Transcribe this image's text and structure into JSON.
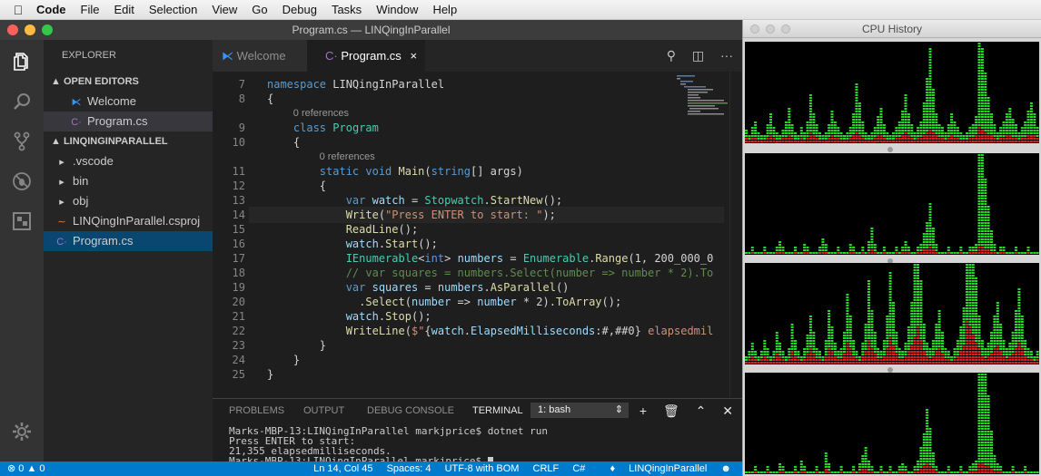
{
  "menubar": {
    "app": "Code",
    "items": [
      "File",
      "Edit",
      "Selection",
      "View",
      "Go",
      "Debug",
      "Tasks",
      "Window",
      "Help"
    ]
  },
  "window": {
    "title": "Program.cs — LINQingInParallel"
  },
  "activity": [
    "files-icon",
    "search-icon",
    "source-control-icon",
    "debug-icon",
    "extensions-icon",
    "settings-icon"
  ],
  "sidebar": {
    "title": "EXPLORER",
    "open_editors_header": "▲ OPEN EDITORS",
    "open_editors": [
      {
        "label": "Welcome",
        "icon": "vscode-icon"
      },
      {
        "label": "Program.cs",
        "icon": "csharp-icon"
      }
    ],
    "project_header": "▲ LINQINGINPARALLEL",
    "project": [
      {
        "label": ".vscode",
        "icon": "▸"
      },
      {
        "label": "bin",
        "icon": "▸"
      },
      {
        "label": "obj",
        "icon": "▸"
      },
      {
        "label": "LINQingInParallel.csproj",
        "icon": "rss-icon"
      },
      {
        "label": "Program.cs",
        "icon": "csharp-icon"
      }
    ]
  },
  "tabs": [
    {
      "label": "Welcome"
    },
    {
      "label": "Program.cs",
      "close": "×"
    }
  ],
  "editor": {
    "lines": [
      {
        "n": "7",
        "tokens": [
          [
            "kw",
            "namespace "
          ],
          [
            "",
            "LINQingInParallel"
          ]
        ]
      },
      {
        "n": "8",
        "tokens": [
          [
            "",
            "{"
          ]
        ]
      },
      {
        "lens": "0 references"
      },
      {
        "n": "9",
        "tokens": [
          [
            "",
            "    "
          ],
          [
            "kw",
            "class "
          ],
          [
            "ty",
            "Program"
          ]
        ]
      },
      {
        "n": "10",
        "tokens": [
          [
            "",
            "    {"
          ]
        ]
      },
      {
        "lens": "0 references"
      },
      {
        "n": "11",
        "tokens": [
          [
            "",
            "        "
          ],
          [
            "kw",
            "static void "
          ],
          [
            "fn",
            "Main"
          ],
          [
            "",
            "("
          ],
          [
            "kw",
            "string"
          ],
          [
            "",
            "[] args)"
          ]
        ]
      },
      {
        "n": "12",
        "tokens": [
          [
            "",
            "        {"
          ]
        ]
      },
      {
        "n": "13",
        "tokens": [
          [
            "",
            "            "
          ],
          [
            "kw",
            "var "
          ],
          [
            "vr",
            "watch"
          ],
          [
            "",
            " = "
          ],
          [
            "ty",
            "Stopwatch"
          ],
          [
            "",
            "."
          ],
          [
            "fn",
            "StartNew"
          ],
          [
            "",
            "();"
          ]
        ]
      },
      {
        "n": "14",
        "tokens": [
          [
            "",
            "            "
          ],
          [
            "fn",
            "Write"
          ],
          [
            "",
            "("
          ],
          [
            "st",
            "\"Press ENTER to start: \""
          ],
          [
            "",
            ");"
          ]
        ]
      },
      {
        "n": "15",
        "tokens": [
          [
            "",
            "            "
          ],
          [
            "fn",
            "ReadLine"
          ],
          [
            "",
            "();"
          ]
        ]
      },
      {
        "n": "16",
        "tokens": [
          [
            "",
            "            "
          ],
          [
            "vr",
            "watch"
          ],
          [
            "",
            "."
          ],
          [
            "fn",
            "Start"
          ],
          [
            "",
            "();"
          ]
        ]
      },
      {
        "n": "17",
        "tokens": [
          [
            "",
            "            "
          ],
          [
            "ty",
            "IEnumerable"
          ],
          [
            "",
            "<"
          ],
          [
            "kw",
            "int"
          ],
          [
            "",
            "> "
          ],
          [
            "vr",
            "numbers"
          ],
          [
            "",
            " = "
          ],
          [
            "ty",
            "Enumerable"
          ],
          [
            "",
            "."
          ],
          [
            "fn",
            "Range"
          ],
          [
            "",
            "(1, 200_000_0"
          ]
        ]
      },
      {
        "n": "18",
        "tokens": [
          [
            "",
            "            "
          ],
          [
            "cm",
            "// var squares = numbers.Select(number => number * 2).To"
          ]
        ]
      },
      {
        "n": "19",
        "tokens": [
          [
            "",
            "            "
          ],
          [
            "kw",
            "var "
          ],
          [
            "vr",
            "squares"
          ],
          [
            "",
            " = "
          ],
          [
            "vr",
            "numbers"
          ],
          [
            "",
            "."
          ],
          [
            "fn",
            "AsParallel"
          ],
          [
            "",
            "()"
          ]
        ]
      },
      {
        "n": "20",
        "tokens": [
          [
            "",
            "              ."
          ],
          [
            "fn",
            "Select"
          ],
          [
            "",
            "("
          ],
          [
            "vr",
            "number"
          ],
          [
            "",
            " => "
          ],
          [
            "vr",
            "number"
          ],
          [
            "",
            " * 2)."
          ],
          [
            "fn",
            "ToArray"
          ],
          [
            "",
            "();"
          ]
        ]
      },
      {
        "n": "21",
        "tokens": [
          [
            "",
            "            "
          ],
          [
            "vr",
            "watch"
          ],
          [
            "",
            "."
          ],
          [
            "fn",
            "Stop"
          ],
          [
            "",
            "();"
          ]
        ]
      },
      {
        "n": "22",
        "tokens": [
          [
            "",
            "            "
          ],
          [
            "fn",
            "WriteLine"
          ],
          [
            "",
            "("
          ],
          [
            "st",
            "$\""
          ],
          [
            "",
            "{"
          ],
          [
            "vr",
            "watch"
          ],
          [
            "",
            "."
          ],
          [
            "vr",
            "ElapsedMilliseconds"
          ],
          [
            "",
            ":#,##0} "
          ],
          [
            "st",
            "elapsedmil"
          ]
        ]
      },
      {
        "n": "23",
        "tokens": [
          [
            "",
            "        }"
          ]
        ]
      },
      {
        "n": "24",
        "tokens": [
          [
            "",
            "    }"
          ]
        ]
      },
      {
        "n": "25",
        "tokens": [
          [
            "",
            "}"
          ]
        ]
      }
    ]
  },
  "panel": {
    "tabs": [
      "PROBLEMS",
      "OUTPUT",
      "DEBUG CONSOLE",
      "TERMINAL"
    ],
    "active": "TERMINAL",
    "terminal_select": "1: bash",
    "terminal_lines": [
      "Marks-MBP-13:LINQingInParallel markjprice$ dotnet run",
      "Press ENTER to start:",
      "21,355 elapsedmilliseconds.",
      "Marks-MBP-13:LINQingInParallel markjprice$ "
    ]
  },
  "status": {
    "errors": "⊗ 0",
    "warnings": "▲ 0",
    "position": "Ln 14, Col 45",
    "spaces": "Spaces: 4",
    "encoding": "UTF-8 with BOM",
    "eol": "CRLF",
    "language": "C#",
    "project": "LINQingInParallel",
    "feedback": "☻"
  },
  "cpu": {
    "title": "CPU History",
    "colors": {
      "user": "#22dd22",
      "system": "#dd2222",
      "background": "#000000"
    },
    "graphs": [
      {
        "user": [
          3,
          2,
          4,
          6,
          3,
          2,
          2,
          5,
          8,
          4,
          3,
          2,
          3,
          6,
          10,
          5,
          3,
          2,
          4,
          3,
          6,
          14,
          8,
          5,
          3,
          2,
          3,
          5,
          9,
          6,
          4,
          3,
          2,
          3,
          4,
          8,
          18,
          12,
          6,
          3,
          2,
          3,
          4,
          7,
          10,
          5,
          3,
          2,
          3,
          4,
          6,
          9,
          14,
          8,
          5,
          3,
          4,
          6,
          12,
          20,
          30,
          16,
          8,
          5,
          4,
          3,
          5,
          8,
          6,
          4,
          3,
          2,
          3,
          4,
          5,
          7,
          38,
          30,
          22,
          14,
          8,
          5,
          3,
          4,
          6,
          8,
          10,
          7,
          5,
          3,
          4,
          6,
          9,
          12,
          8,
          4
        ],
        "system": [
          2,
          1,
          2,
          2,
          1,
          1,
          1,
          2,
          3,
          2,
          1,
          1,
          2,
          2,
          3,
          2,
          1,
          1,
          2,
          1,
          2,
          4,
          3,
          2,
          1,
          1,
          1,
          2,
          3,
          2,
          2,
          1,
          1,
          1,
          2,
          3,
          4,
          3,
          2,
          1,
          1,
          1,
          2,
          3,
          3,
          2,
          1,
          1,
          1,
          2,
          2,
          3,
          4,
          3,
          2,
          1,
          2,
          2,
          3,
          4,
          5,
          4,
          3,
          2,
          2,
          1,
          2,
          3,
          2,
          2,
          1,
          1,
          1,
          2,
          2,
          3,
          6,
          5,
          4,
          3,
          3,
          2,
          1,
          2,
          2,
          3,
          3,
          2,
          2,
          1,
          2,
          2,
          3,
          3,
          3,
          2
        ]
      },
      {
        "user": [
          1,
          1,
          2,
          1,
          1,
          1,
          2,
          1,
          1,
          1,
          2,
          4,
          2,
          1,
          1,
          1,
          2,
          1,
          1,
          3,
          2,
          1,
          1,
          1,
          2,
          5,
          3,
          1,
          1,
          1,
          2,
          1,
          1,
          1,
          3,
          2,
          1,
          1,
          2,
          1,
          4,
          8,
          3,
          1,
          1,
          2,
          1,
          1,
          1,
          2,
          1,
          2,
          4,
          2,
          1,
          1,
          2,
          3,
          6,
          10,
          16,
          8,
          3,
          1,
          1,
          1,
          2,
          1,
          1,
          1,
          2,
          1,
          1,
          2,
          2,
          3,
          40,
          34,
          26,
          16,
          8,
          3,
          1,
          2,
          2,
          1,
          1,
          1,
          2,
          1,
          1,
          1,
          2,
          1,
          1,
          1
        ],
        "system": [
          0,
          0,
          1,
          0,
          0,
          0,
          1,
          0,
          0,
          0,
          1,
          1,
          1,
          0,
          0,
          0,
          1,
          0,
          0,
          1,
          1,
          0,
          0,
          0,
          1,
          1,
          1,
          0,
          0,
          0,
          1,
          0,
          0,
          0,
          1,
          1,
          0,
          0,
          1,
          0,
          1,
          2,
          1,
          0,
          0,
          1,
          0,
          0,
          0,
          1,
          0,
          1,
          1,
          1,
          0,
          0,
          1,
          1,
          2,
          2,
          3,
          2,
          1,
          0,
          0,
          0,
          1,
          0,
          0,
          0,
          1,
          0,
          0,
          1,
          1,
          1,
          3,
          3,
          2,
          2,
          1,
          1,
          0,
          1,
          1,
          0,
          0,
          0,
          1,
          0,
          0,
          0,
          1,
          0,
          0,
          0
        ]
      },
      {
        "user": [
          2,
          3,
          5,
          3,
          2,
          3,
          6,
          4,
          2,
          3,
          8,
          5,
          3,
          2,
          4,
          10,
          6,
          3,
          2,
          4,
          7,
          12,
          8,
          4,
          3,
          2,
          6,
          14,
          9,
          5,
          3,
          4,
          8,
          18,
          12,
          6,
          3,
          2,
          5,
          10,
          22,
          14,
          8,
          4,
          3,
          6,
          12,
          24,
          16,
          8,
          4,
          3,
          5,
          9,
          16,
          28,
          40,
          22,
          10,
          5,
          4,
          6,
          10,
          14,
          8,
          4,
          3,
          2,
          4,
          6,
          9,
          14,
          52,
          44,
          36,
          24,
          12,
          6,
          4,
          5,
          8,
          12,
          16,
          10,
          6,
          4,
          5,
          8,
          14,
          20,
          12,
          6,
          4,
          3,
          2,
          3
        ],
        "system": [
          1,
          2,
          3,
          2,
          1,
          2,
          3,
          2,
          1,
          2,
          4,
          3,
          2,
          1,
          2,
          5,
          3,
          2,
          1,
          2,
          4,
          6,
          4,
          2,
          2,
          1,
          3,
          6,
          5,
          3,
          2,
          2,
          4,
          8,
          6,
          3,
          2,
          1,
          3,
          5,
          9,
          6,
          4,
          2,
          2,
          3,
          6,
          10,
          7,
          4,
          2,
          2,
          3,
          5,
          7,
          10,
          14,
          9,
          5,
          3,
          2,
          3,
          5,
          6,
          4,
          2,
          2,
          1,
          2,
          3,
          5,
          7,
          16,
          14,
          11,
          8,
          6,
          3,
          2,
          3,
          4,
          6,
          7,
          5,
          3,
          2,
          3,
          4,
          6,
          8,
          6,
          3,
          2,
          2,
          1,
          2
        ]
      },
      {
        "user": [
          1,
          1,
          1,
          2,
          1,
          1,
          1,
          2,
          1,
          1,
          1,
          3,
          2,
          1,
          1,
          1,
          2,
          1,
          4,
          2,
          1,
          1,
          1,
          2,
          1,
          1,
          6,
          3,
          1,
          1,
          1,
          2,
          1,
          1,
          1,
          2,
          1,
          3,
          5,
          8,
          4,
          2,
          1,
          1,
          2,
          1,
          1,
          2,
          1,
          1,
          2,
          3,
          2,
          1,
          1,
          2,
          4,
          8,
          12,
          20,
          14,
          6,
          2,
          1,
          1,
          1,
          2,
          1,
          1,
          1,
          2,
          1,
          1,
          2,
          3,
          4,
          50,
          44,
          36,
          26,
          14,
          6,
          3,
          2,
          1,
          1,
          1,
          2,
          1,
          1,
          1,
          2,
          1,
          1,
          1,
          1
        ],
        "system": [
          0,
          0,
          0,
          1,
          0,
          0,
          0,
          1,
          0,
          0,
          0,
          1,
          1,
          0,
          0,
          0,
          1,
          0,
          1,
          1,
          0,
          0,
          0,
          1,
          0,
          0,
          2,
          1,
          0,
          0,
          0,
          1,
          0,
          0,
          0,
          1,
          0,
          1,
          2,
          2,
          1,
          1,
          0,
          0,
          1,
          0,
          0,
          1,
          0,
          0,
          1,
          1,
          1,
          0,
          0,
          1,
          1,
          2,
          3,
          4,
          3,
          2,
          1,
          0,
          0,
          0,
          1,
          0,
          0,
          0,
          1,
          0,
          0,
          1,
          1,
          1,
          4,
          4,
          3,
          3,
          2,
          1,
          1,
          1,
          0,
          0,
          0,
          1,
          0,
          0,
          0,
          1,
          0,
          0,
          0,
          0
        ]
      }
    ]
  }
}
